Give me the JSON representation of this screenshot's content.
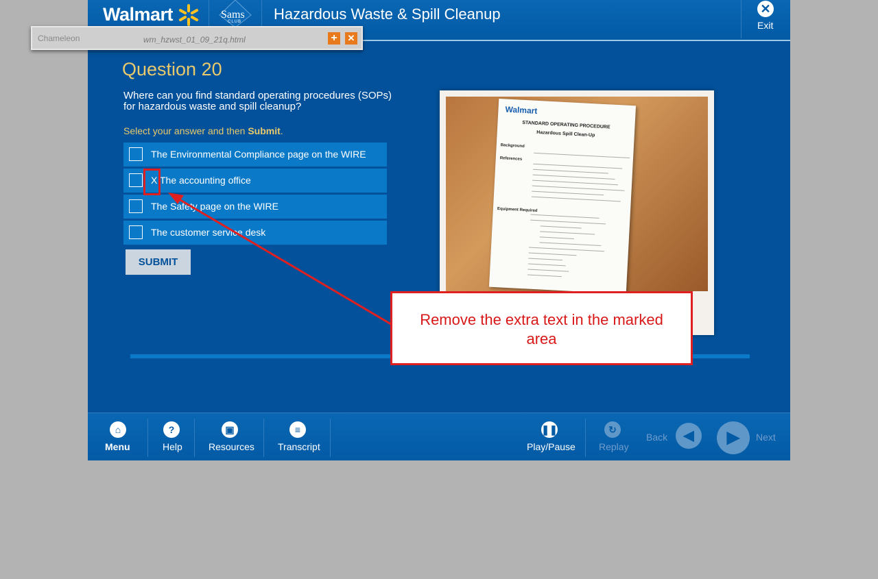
{
  "header": {
    "walmart_logo": "Walmart",
    "sams_logo": "Sams",
    "sams_sub": "CLUB",
    "course_title": "Hazardous Waste & Spill Cleanup",
    "exit_label": "Exit"
  },
  "chameleon": {
    "logo": "Chameleon",
    "filename": "wm_hzwst_01_09_21q.html",
    "plus": "+",
    "close": "✕"
  },
  "question": {
    "title": "Question 20",
    "text": "Where can you find standard operating procedures (SOPs) for hazardous waste and spill cleanup?",
    "instruction_prefix": "Select your answer and then ",
    "instruction_bold": "Submit",
    "instruction_suffix": ".",
    "options": [
      {
        "label": "The Environmental Compliance page on the WIRE",
        "checked": false
      },
      {
        "label": "X The accounting office",
        "checked": false
      },
      {
        "label": "The Safety page on the WIRE",
        "checked": false
      },
      {
        "label": "The customer service desk",
        "checked": false
      }
    ],
    "submit_label": "SUBMIT"
  },
  "document": {
    "brand": "Walmart",
    "heading": "STANDARD OPERATING PROCEDURE",
    "subheading": "Hazardous Spill Clean-Up",
    "sections": [
      "Background",
      "References",
      "Equipment Required"
    ]
  },
  "footer": {
    "menu": "Menu",
    "help": "Help",
    "resources": "Resources",
    "transcript": "Transcript",
    "play_pause": "Play/Pause",
    "replay": "Replay",
    "back": "Back",
    "next": "Next"
  },
  "annotation": {
    "text": "Remove the extra text in the marked area",
    "color": "#e02020"
  },
  "colors": {
    "background": "#02519a",
    "accent_gold": "#e8c96b",
    "option_bg": "#0a79c8"
  }
}
